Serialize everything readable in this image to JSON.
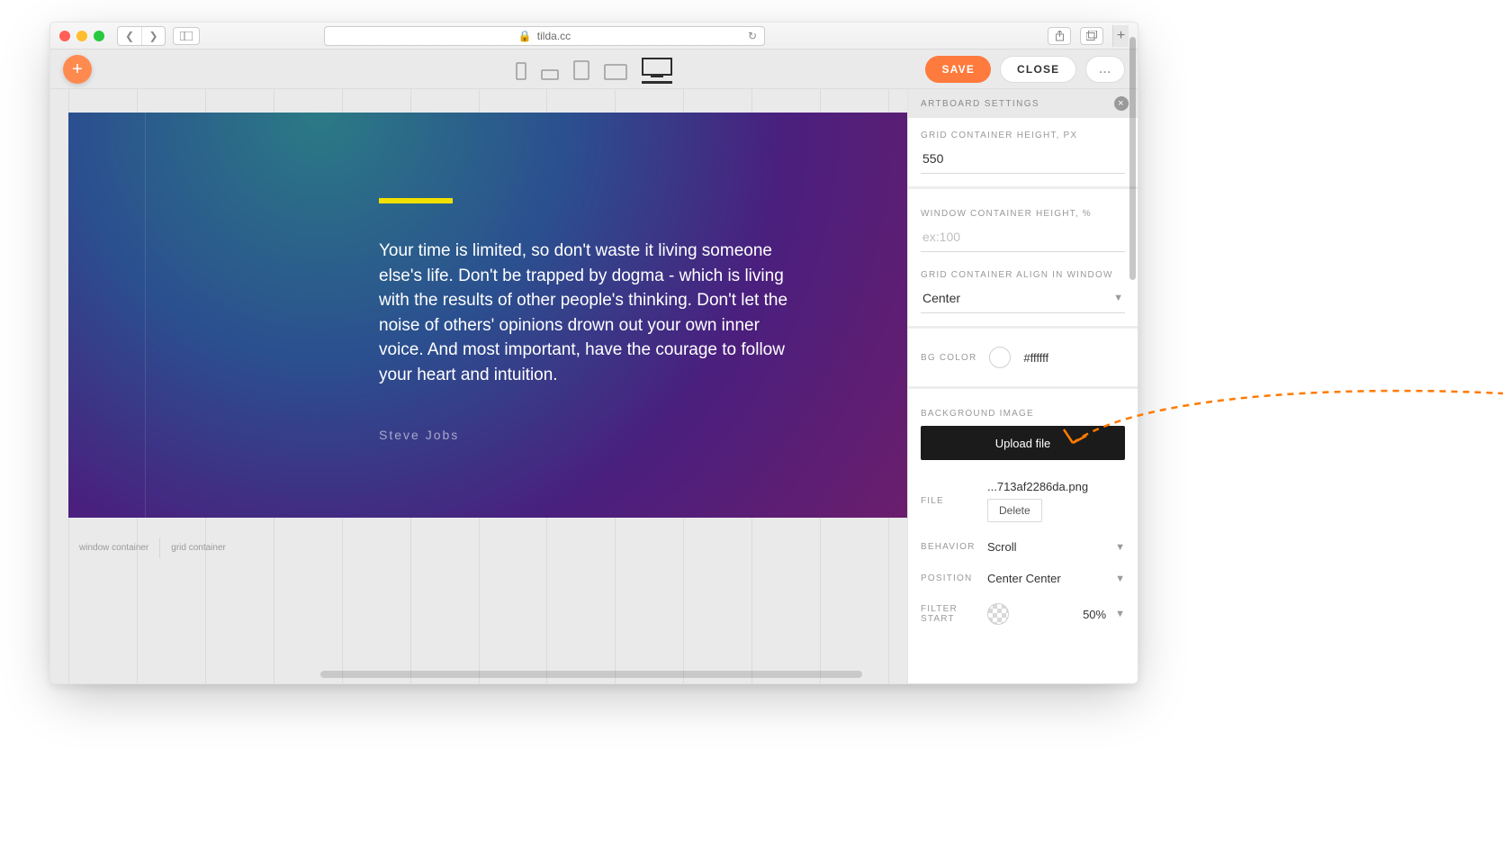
{
  "browser": {
    "url_host": "tilda.cc",
    "lock_icon": "🔒"
  },
  "toolbar": {
    "save": "SAVE",
    "close": "CLOSE",
    "more": "..."
  },
  "canvas": {
    "quote_text": "Your time is limited, so don't waste it living someone else's life. Don't be trapped by dogma - which is living with the results of other people's thinking. Don't let the noise of others' opinions drown out your own inner voice. And most important, have the courage to follow your heart and intuition.",
    "author": "Steve Jobs",
    "tab_window": "window container",
    "tab_grid": "grid container"
  },
  "panel": {
    "title": "ARTBOARD SETTINGS",
    "grid_height": {
      "label": "GRID CONTAINER HEIGHT, PX",
      "value": "550"
    },
    "window_height": {
      "label": "WINDOW CONTAINER HEIGHT, %",
      "placeholder": "ex:100"
    },
    "align": {
      "label": "GRID CONTAINER ALIGN IN WINDOW",
      "value": "Center"
    },
    "bgcolor": {
      "label": "BG COLOR",
      "value": "#ffffff"
    },
    "bgimage": {
      "label": "BACKGROUND IMAGE",
      "upload": "Upload file"
    },
    "file": {
      "label": "FILE",
      "value": "...713af2286da.png",
      "delete": "Delete"
    },
    "behavior": {
      "label": "BEHAVIOR",
      "value": "Scroll"
    },
    "position": {
      "label": "POSITION",
      "value": "Center Center"
    },
    "filter_start": {
      "label": "FILTER START",
      "value": "50%"
    }
  }
}
